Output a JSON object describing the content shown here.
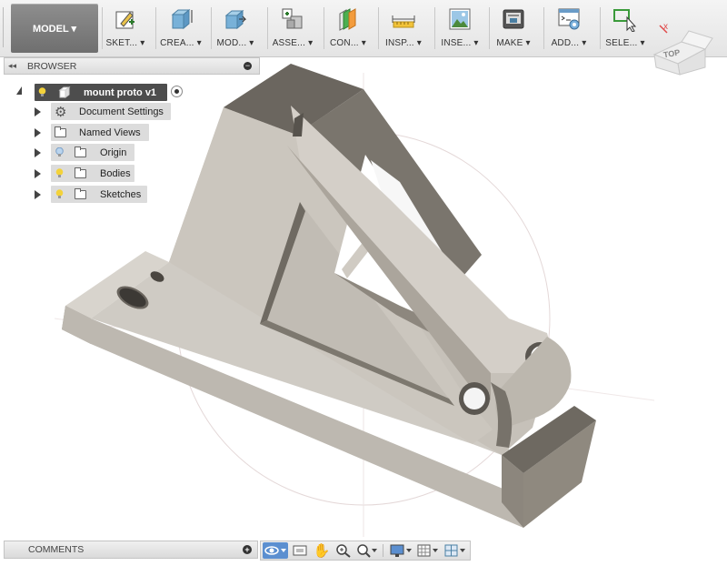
{
  "toolbar": {
    "workspace": "MODEL ▾",
    "tools": [
      {
        "label": "SKET... ▾",
        "icon": "sketch-icon"
      },
      {
        "label": "CREA... ▾",
        "icon": "create-icon"
      },
      {
        "label": "MOD... ▾",
        "icon": "modify-icon"
      },
      {
        "label": "ASSE... ▾",
        "icon": "assemble-icon"
      },
      {
        "label": "CON... ▾",
        "icon": "construct-icon"
      },
      {
        "label": "INSP... ▾",
        "icon": "inspect-icon"
      },
      {
        "label": "INSE... ▾",
        "icon": "insert-icon"
      },
      {
        "label": "MAKE ▾",
        "icon": "make-icon"
      },
      {
        "label": "ADD... ▾",
        "icon": "addins-icon"
      },
      {
        "label": "SELE... ▾",
        "icon": "select-icon"
      }
    ]
  },
  "browser": {
    "title": "BROWSER",
    "root": "mount proto v1",
    "items": [
      {
        "label": "Document Settings",
        "icon": "gear-icon"
      },
      {
        "label": "Named Views",
        "icon": "folder-icon"
      },
      {
        "label": "Origin",
        "icon": "folder-icon"
      },
      {
        "label": "Bodies",
        "icon": "folder-icon"
      },
      {
        "label": "Sketches",
        "icon": "folder-icon"
      }
    ]
  },
  "viewcube": {
    "face": "TOP"
  },
  "comments": {
    "title": "COMMENTS"
  },
  "colors": {
    "model_face": "#c9c4bc",
    "model_dark": "#6b665f",
    "active_nav": "#5b8fd0"
  }
}
